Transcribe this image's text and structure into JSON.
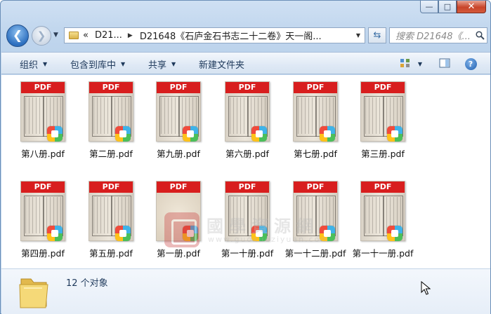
{
  "window": {
    "caption_min": "—",
    "caption_max": "□",
    "caption_close": "✕"
  },
  "nav": {
    "back_glyph": "❮",
    "forward_glyph": "❯",
    "history_glyph": "▼",
    "address_overflow": "«",
    "address_parent": "D21...",
    "address_sep": "▶",
    "address_current": "D21648《石庐金石书志二十二卷》天一阁...",
    "address_dropdown": "▼",
    "refresh_glyph": "⇆",
    "search_placeholder": "搜索 D21648《..."
  },
  "toolbar": {
    "organize": "组织",
    "include_library": "包含到库中",
    "share": "共享",
    "new_folder": "新建文件夹",
    "dropdown_glyph": "▼",
    "help_glyph": "?"
  },
  "files": [
    {
      "name": "第八册.pdf",
      "thumb": "text"
    },
    {
      "name": "第二册.pdf",
      "thumb": "text"
    },
    {
      "name": "第九册.pdf",
      "thumb": "text"
    },
    {
      "name": "第六册.pdf",
      "thumb": "text"
    },
    {
      "name": "第七册.pdf",
      "thumb": "text"
    },
    {
      "name": "第三册.pdf",
      "thumb": "text"
    },
    {
      "name": "第四册.pdf",
      "thumb": "text"
    },
    {
      "name": "第五册.pdf",
      "thumb": "text"
    },
    {
      "name": "第一册.pdf",
      "thumb": "plain"
    },
    {
      "name": "第一十册.pdf",
      "thumb": "text"
    },
    {
      "name": "第一十二册.pdf",
      "thumb": "text"
    },
    {
      "name": "第一十一册.pdf",
      "thumb": "text"
    }
  ],
  "pdf_label": "PDF",
  "watermark": {
    "cn": "國學資源網",
    "url": "www.guoxueziyuan.com"
  },
  "status": {
    "item_count": "12 个对象"
  },
  "colors": {
    "pdf_band": "#d81e1e",
    "command_text": "#1e395b",
    "window_frame": "#bcd3ec"
  },
  "icons": [
    "back-arrow-icon",
    "forward-arrow-icon",
    "folder-icon",
    "refresh-icon",
    "search-icon",
    "view-options-icon",
    "preview-pane-icon",
    "help-icon",
    "pdf-reader-app-icon",
    "mouse-cursor-icon"
  ]
}
